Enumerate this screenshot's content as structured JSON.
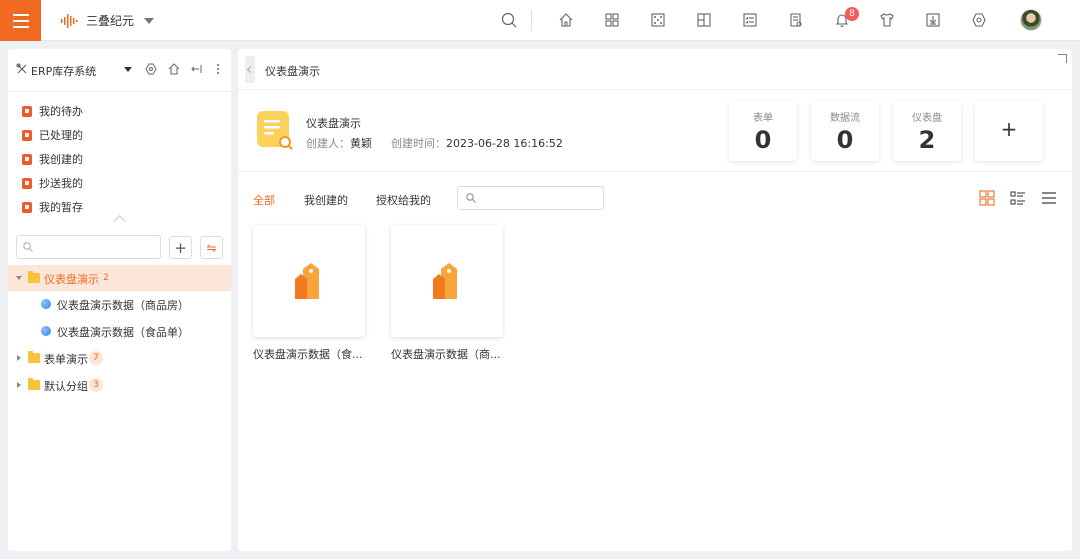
{
  "topbar": {
    "brand_name": "三叠纪元",
    "notification_count": "8",
    "icons": [
      "search-icon",
      "home-icon",
      "apps-icon",
      "dice-icon",
      "widgets-icon",
      "checklist-icon",
      "report-icon",
      "bell-icon",
      "shirt-icon",
      "download-icon",
      "settings-icon"
    ]
  },
  "sidebar": {
    "system_name": "ERP库存系统",
    "quick_items": [
      {
        "label": "我的待办"
      },
      {
        "label": "已处理的"
      },
      {
        "label": "我创建的"
      },
      {
        "label": "抄送我的"
      },
      {
        "label": "我的暂存"
      }
    ],
    "search_placeholder": "",
    "add_label": "+",
    "switch_label": "⇋",
    "tree": [
      {
        "label": "仪表盘演示",
        "count": "2",
        "expanded": true,
        "active": true,
        "children": [
          {
            "label": "仪表盘演示数据（商品房）"
          },
          {
            "label": "仪表盘演示数据（食品单）"
          }
        ]
      },
      {
        "label": "表单演示",
        "count": "7"
      },
      {
        "label": "默认分组",
        "count": "3"
      }
    ]
  },
  "main": {
    "breadcrumb": "仪表盘演示",
    "dashboard": {
      "title": "仪表盘演示",
      "creator_label": "创建人：",
      "creator": "黄颖",
      "created_label": "创建时间：",
      "created_time": "2023-06-28 16:16:52"
    },
    "stats": [
      {
        "label": "表单",
        "value": "0"
      },
      {
        "label": "数据流",
        "value": "0"
      },
      {
        "label": "仪表盘",
        "value": "2"
      }
    ],
    "add_label": "+",
    "filters": [
      "全部",
      "我创建的",
      "授权给我的"
    ],
    "search_placeholder": "",
    "cards": [
      {
        "label": "仪表盘演示数据（食..."
      },
      {
        "label": "仪表盘演示数据（商..."
      }
    ]
  },
  "colors": {
    "accent": "#f26a22",
    "badge": "#f25c5c",
    "folder": "#f8c23b"
  }
}
